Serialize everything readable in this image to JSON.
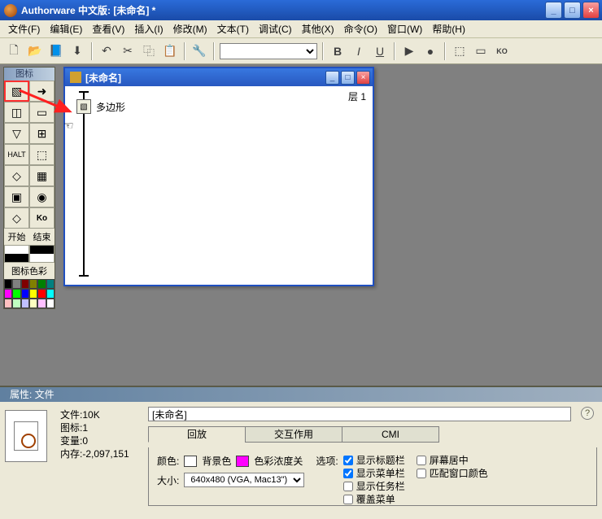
{
  "titlebar": {
    "title": "Authorware 中文版: [未命名] *"
  },
  "menu": {
    "file": "文件(F)",
    "edit": "编辑(E)",
    "view": "查看(V)",
    "insert": "插入(I)",
    "modify": "修改(M)",
    "text": "文本(T)",
    "debug": "调试(C)",
    "other": "其他(X)",
    "command": "命令(O)",
    "window": "窗口(W)",
    "help": "帮助(H)"
  },
  "toolbar": {
    "bold": "B",
    "italic": "I",
    "underline": "U"
  },
  "palette": {
    "title": "图标",
    "start": "开始",
    "end": "结束",
    "color_label": "图标色彩",
    "colors": [
      "#000000",
      "#808080",
      "#800000",
      "#808000",
      "#008000",
      "#008080",
      "#ff00ff",
      "#00ff00",
      "#0000ff",
      "#ffff00",
      "#ff0000",
      "#00ffff",
      "#ffc0c0",
      "#c0ffc0",
      "#c0c0ff",
      "#ffffc0",
      "#ffc0ff",
      "#ffffff"
    ]
  },
  "flowwin": {
    "title": "[未命名]",
    "level_label": "层",
    "level_value": "1",
    "node_label": "多边形"
  },
  "props": {
    "title": "属性: 文件",
    "file_label": "文件:",
    "file_value": "10K",
    "icon_label": "图标:",
    "icon_value": "1",
    "var_label": "变量:",
    "var_value": "0",
    "mem_label": "内存:",
    "mem_value": "-2,097,151",
    "name": "[未命名]",
    "tabs": {
      "playback": "回放",
      "interact": "交互作用",
      "cmi": "CMI"
    },
    "color_label": "颜色:",
    "bg_label": "背景色",
    "chroma_label": "色彩浓度关",
    "size_label": "大小:",
    "size_value": "640x480 (VGA, Mac13\")",
    "options_label": "选项:",
    "opt1": "显示标题栏",
    "opt2": "显示菜单栏",
    "opt3": "显示任务栏",
    "opt4": "覆盖菜单",
    "opt5": "屏幕居中",
    "opt6": "匹配窗口颜色",
    "chroma_color": "#ff00ff"
  }
}
